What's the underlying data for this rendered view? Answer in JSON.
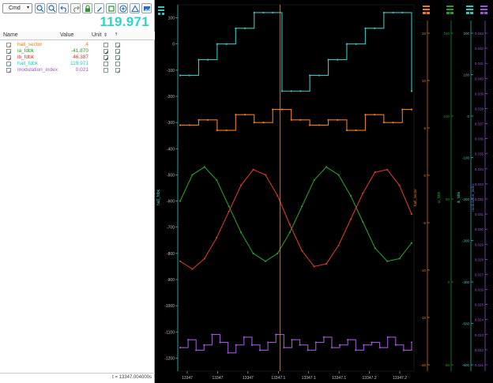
{
  "toolbar": {
    "cmd_label": "Cmd",
    "icons": [
      "zoom-in-icon",
      "zoom-out-icon",
      "undo-icon",
      "redo-icon",
      "lock-icon",
      "pen-icon",
      "square-icon",
      "plus-circle-icon",
      "triangle-icon",
      "image-icon"
    ]
  },
  "big_value": "119.971",
  "table": {
    "headers": {
      "name": "Name",
      "value": "Value",
      "unit": "Unit"
    },
    "rows": [
      {
        "name": "hall_sector",
        "value": "4",
        "color": "#f07c18"
      },
      {
        "name": "ia_fdbk",
        "value": "-41.870",
        "color": "#2a9a2a"
      },
      {
        "name": "ib_fdbk",
        "value": "46.387",
        "color": "#d23a2a"
      },
      {
        "name": "hall_fdbk",
        "value": "119.971",
        "color": "#2fc8c0"
      },
      {
        "name": "modulation_index",
        "value": "0.021",
        "color": "#9a58d2"
      }
    ]
  },
  "footer": "t = 13347.004000s",
  "chart_data": {
    "type": "line",
    "xlabel": "",
    "x_ticks": [
      "13347",
      "13347",
      "13347",
      "13347.1",
      "13347.1",
      "13347.1",
      "13347.2",
      "13347.2"
    ],
    "cursor_x_fraction": 0.433,
    "axes": [
      {
        "label": "hall_fdbk",
        "color": "#2fc8c0",
        "ticks": [
          "-1200",
          "-1100",
          "-1000",
          "-900",
          "-800",
          "-700",
          "-600",
          "-500",
          "-400",
          "-300",
          "-200",
          "-100",
          "0",
          "100"
        ]
      },
      {
        "label": "hall_sector",
        "color": "#f07c18",
        "ticks": [
          "-20",
          "-15",
          "-10",
          "-5",
          "0",
          "5",
          "10",
          "15"
        ]
      },
      {
        "label": "ia_fdbk",
        "color": "#2a9a2a",
        "ticks": [
          "-50",
          "0",
          "50",
          "100",
          "150"
        ]
      },
      {
        "label": "ib_fdbk",
        "color": "#2fc8c0",
        "ticks": [
          "-600",
          "-500",
          "-400",
          "-300",
          "-200",
          "-100",
          "0",
          "100",
          "200"
        ]
      },
      {
        "label": "modulation_index",
        "color": "#9a58d2",
        "ticks": [
          "0.021",
          "0.022",
          "0.023",
          "0.024",
          "0.025",
          "0.026",
          "0.027",
          "0.028",
          "0.029",
          "0.030",
          "0.031",
          "0.032",
          "0.033",
          "0.034",
          "0.035",
          "0.036",
          "0.037",
          "0.038",
          "0.039",
          "0.040",
          "0.041",
          "0.042",
          "0.043"
        ]
      }
    ],
    "series": [
      {
        "name": "hall_fdbk",
        "color": "#2fc8c0",
        "values": [
          -120,
          -120,
          -60,
          -60,
          0,
          0,
          60,
          60,
          120,
          120,
          120,
          -180,
          -180,
          -180,
          -120,
          -120,
          -60,
          -60,
          0,
          0,
          60,
          60,
          120,
          120,
          120,
          -180
        ]
      },
      {
        "name": "hall_sector",
        "color": "#f07c18",
        "values": [
          -310,
          -310,
          -290,
          -290,
          -330,
          -330,
          -270,
          -270,
          -300,
          -300,
          -250,
          -250,
          -290,
          -290,
          -310,
          -310,
          -290,
          -290,
          -330,
          -330,
          -270,
          -270,
          -300,
          -300,
          -250,
          -250
        ]
      },
      {
        "name": "ia_fdbk",
        "color": "#2a9a2a",
        "values": [
          -600,
          -500,
          -470,
          -520,
          -620,
          -720,
          -800,
          -830,
          -800,
          -720,
          -620,
          -520,
          -470,
          -500,
          -580,
          -680,
          -780,
          -830,
          -820,
          -760
        ]
      },
      {
        "name": "ib_fdbk",
        "color": "#d23a2a",
        "values": [
          -830,
          -860,
          -820,
          -740,
          -640,
          -540,
          -480,
          -500,
          -580,
          -690,
          -790,
          -850,
          -840,
          -770,
          -670,
          -570,
          -490,
          -480,
          -540,
          -650
        ]
      },
      {
        "name": "modulation_index",
        "color": "#9a58d2",
        "values": [
          -1160,
          -1130,
          -1170,
          -1150,
          -1110,
          -1140,
          -1180,
          -1150,
          -1120,
          -1150,
          -1170,
          -1140,
          -1110,
          -1160,
          -1130,
          -1150,
          -1170,
          -1140,
          -1120,
          -1160,
          -1150,
          -1130,
          -1170,
          -1150,
          -1140,
          -1160,
          -1120,
          -1150,
          -1170,
          -1140
        ]
      }
    ]
  }
}
